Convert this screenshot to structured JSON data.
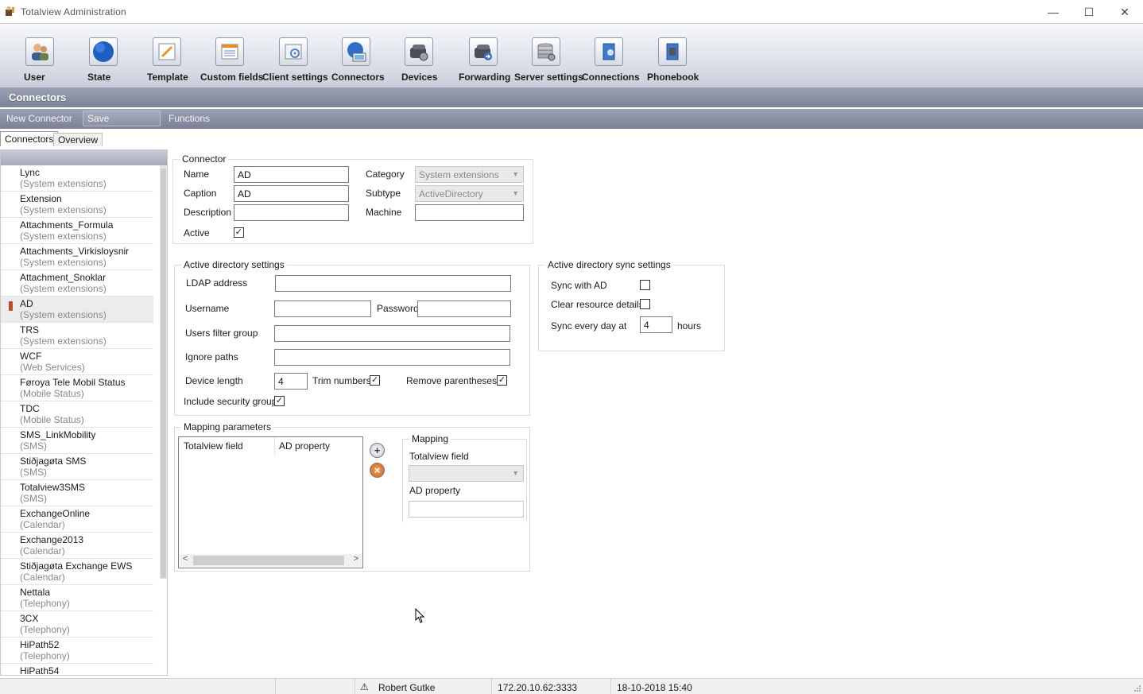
{
  "window": {
    "title": "Totalview  Administration",
    "minimize": "—",
    "maximize": "☐",
    "close": "✕"
  },
  "ribbon": {
    "buttons": [
      {
        "label": "User",
        "icon": "user-icon"
      },
      {
        "label": "State",
        "icon": "globe-icon"
      },
      {
        "label": "Template",
        "icon": "template-icon"
      },
      {
        "label": "Custom fields",
        "icon": "custom-fields-icon"
      },
      {
        "label": "Client settings",
        "icon": "client-settings-icon"
      },
      {
        "label": "Connectors",
        "icon": "connectors-icon"
      },
      {
        "label": "Devices",
        "icon": "devices-icon"
      },
      {
        "label": "Forwarding",
        "icon": "forwarding-icon"
      },
      {
        "label": "Server settings",
        "icon": "server-settings-icon"
      },
      {
        "label": "Connections",
        "icon": "connections-icon"
      },
      {
        "label": "Phonebook",
        "icon": "phonebook-icon"
      }
    ],
    "section": "Connectors"
  },
  "toolbar": {
    "new_connector": "New Connector",
    "save": "Save",
    "functions": "Functions"
  },
  "tabs": [
    {
      "label": "Connectors"
    },
    {
      "label": "Overview"
    }
  ],
  "connectors": [
    {
      "name": "Lync",
      "category": "(System extensions)"
    },
    {
      "name": "Extension",
      "category": "(System extensions)"
    },
    {
      "name": "Attachments_Formula",
      "category": "(System extensions)"
    },
    {
      "name": "Attachments_Virkisloysnir",
      "category": "(System extensions)"
    },
    {
      "name": "Attachment_Snoklar",
      "category": "(System extensions)"
    },
    {
      "name": "AD",
      "category": "(System extensions)",
      "selected": true
    },
    {
      "name": "TRS",
      "category": "(System extensions)"
    },
    {
      "name": "WCF",
      "category": "(Web Services)"
    },
    {
      "name": "Føroya Tele Mobil Status",
      "category": "(Mobile Status)"
    },
    {
      "name": "TDC",
      "category": "(Mobile Status)"
    },
    {
      "name": "SMS_LinkMobility",
      "category": "(SMS)"
    },
    {
      "name": "Stiðjagøta SMS",
      "category": "(SMS)"
    },
    {
      "name": "Totalview3SMS",
      "category": "(SMS)"
    },
    {
      "name": "ExchangeOnline",
      "category": "(Calendar)"
    },
    {
      "name": "Exchange2013",
      "category": "(Calendar)"
    },
    {
      "name": "Stiðjagøta Exchange EWS",
      "category": "(Calendar)"
    },
    {
      "name": "Nettala",
      "category": "(Telephony)"
    },
    {
      "name": "3CX",
      "category": "(Telephony)"
    },
    {
      "name": "HiPath52",
      "category": "(Telephony)"
    },
    {
      "name": "HiPath54",
      "category": ""
    }
  ],
  "connector": {
    "group_title": "Connector",
    "name_label": "Name",
    "name_value": "AD",
    "caption_label": "Caption",
    "caption_value": "AD",
    "description_label": "Description",
    "description_value": "",
    "active_label": "Active",
    "active_mark": "✓",
    "category_label": "Category",
    "category_value": "System extensions",
    "subtype_label": "Subtype",
    "subtype_value": "ActiveDirectory",
    "machine_label": "Machine",
    "machine_value": ""
  },
  "ad_settings": {
    "group_title": "Active directory settings",
    "ldap_label": "LDAP address",
    "ldap_value": "",
    "username_label": "Username",
    "username_value": "",
    "password_label": "Password",
    "password_value": "",
    "users_filter_label": "Users filter group",
    "users_filter_value": "",
    "ignore_paths_label": "Ignore paths",
    "ignore_paths_value": "",
    "device_length_label": "Device length",
    "device_length_value": "4",
    "trim_numbers_label": "Trim numbers",
    "trim_mark": "✓",
    "remove_parentheses_label": "Remove parentheses",
    "remove_mark": "✓",
    "include_security_label": "Include security groups",
    "include_mark": "✓"
  },
  "sync_settings": {
    "group_title": "Active directory sync settings",
    "sync_ad_label": "Sync with AD",
    "clear_resource_label": "Clear resource details",
    "sync_every_label": "Sync every day at",
    "sync_every_value": "4",
    "hours_label": "hours"
  },
  "mapping": {
    "group_title": "Mapping parameters",
    "col_totalview": "Totalview field",
    "col_ad": "AD property",
    "scroll_left": "<",
    "scroll_right": ">",
    "add_glyph": "+",
    "remove_glyph": "×",
    "inner_title": "Mapping",
    "tv_field_label": "Totalview field",
    "tv_field_value": "",
    "ad_property_label": "AD property",
    "ad_property_value": ""
  },
  "status": {
    "warning_glyph": "⚠",
    "user": "Robert Gutke",
    "address": "172.20.10.62:3333",
    "datetime": "18-10-2018 15:40"
  }
}
